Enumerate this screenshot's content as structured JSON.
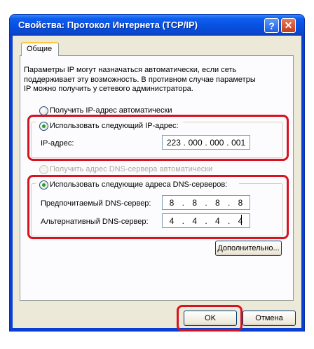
{
  "window": {
    "title": "Свойства: Протокол Интернета (TCP/IP)",
    "help_symbol": "?",
    "close_symbol": "✕"
  },
  "tabs": [
    {
      "label": "Общие",
      "active": true
    }
  ],
  "description": [
    "Параметры IP могут назначаться автоматически, если сеть",
    "поддерживает эту возможность. В противном случае параметры",
    "IP можно получить у сетевого администратора."
  ],
  "ip_section": {
    "auto_radio_label": "Получить IP-адрес автоматически",
    "manual_radio_label": "Использовать следующий IP-адрес:",
    "ip_label": "IP-адрес:",
    "ip_value": [
      "223",
      "000",
      "000",
      "001"
    ]
  },
  "dns_section": {
    "auto_radio_label": "Получить адрес DNS-сервера автоматически",
    "manual_radio_label": "Использовать следующие адреса DNS-серверов:",
    "preferred_label": "Предпочитаемый DNS-сервер:",
    "preferred_value": [
      "8",
      "8",
      "8",
      "8"
    ],
    "alternate_label": "Альтернативный DNS-сервер:",
    "alternate_value": [
      "4",
      "4",
      "4",
      "4"
    ]
  },
  "buttons": {
    "advanced": "Дополнительно...",
    "ok": "OK",
    "cancel": "Отмена"
  },
  "colors": {
    "highlight": "#d8121f",
    "titlebar": "#0a48cf",
    "dialog_bg": "#ece9d8"
  }
}
